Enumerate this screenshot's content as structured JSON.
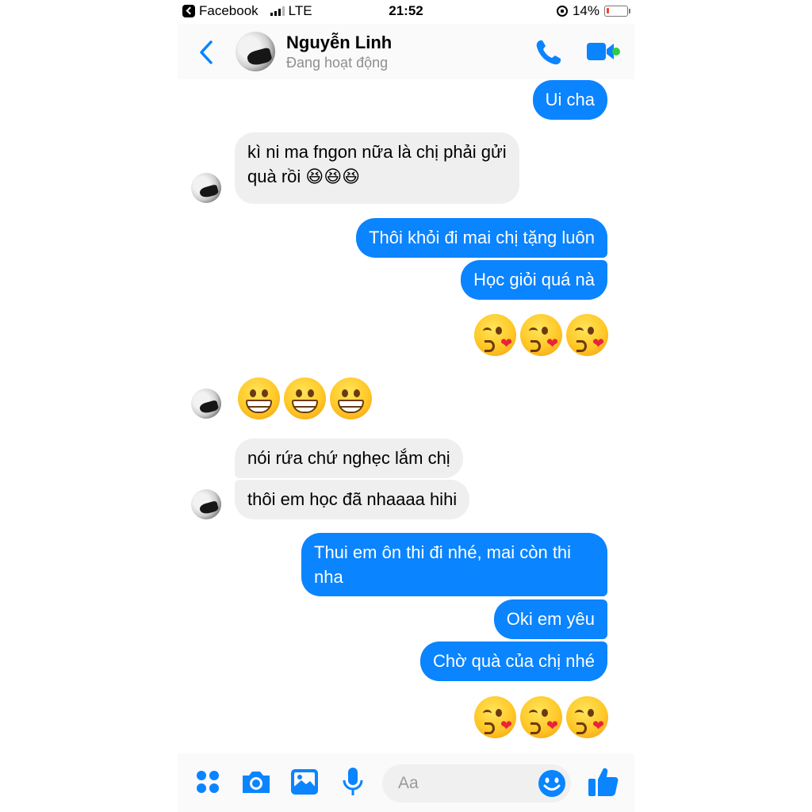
{
  "status_bar": {
    "back_app": "Facebook",
    "network": "LTE",
    "time": "21:52",
    "battery": "14%",
    "battery_level_percent": 14,
    "battery_color": "#ff3b30"
  },
  "header": {
    "name": "Nguyễn Linh",
    "status": "Đang hoạt động",
    "accent": "#0a84ff",
    "online_color": "#31cc46",
    "icons": [
      "chevron-left-icon",
      "phone-icon",
      "video-camera-icon"
    ]
  },
  "messages": [
    {
      "from": "me",
      "text": "Ui cha"
    },
    {
      "from": "them",
      "lines": [
        "kì ni ma fngon nữa là chị phải gửi",
        "quà rồi"
      ],
      "emoji": "laughing x3"
    },
    {
      "from": "me",
      "text": "Thôi khỏi đi mai chị tặng luôn"
    },
    {
      "from": "me",
      "text": "Học giỏi quá nà"
    },
    {
      "from": "me",
      "emoji": "kissing-heart x3"
    },
    {
      "from": "them",
      "emoji": "grinning x3"
    },
    {
      "from": "them",
      "text": "nói rứa chứ nghẹc lắm chị"
    },
    {
      "from": "them",
      "text": "thôi em học đã nhaaaa hihi"
    },
    {
      "from": "me",
      "lines": [
        "Thui em ôn thi đi nhé, mai còn thi",
        "nha"
      ]
    },
    {
      "from": "me",
      "text": "Oki em yêu"
    },
    {
      "from": "me",
      "text": "Chờ quà của chị nhé"
    },
    {
      "from": "me",
      "emoji": "kissing-heart x3"
    }
  ],
  "composer": {
    "placeholder": "Aa",
    "icons": [
      "apps-icon",
      "camera-icon",
      "photo-icon",
      "microphone-icon",
      "emoji-icon",
      "thumbs-up-icon"
    ]
  }
}
